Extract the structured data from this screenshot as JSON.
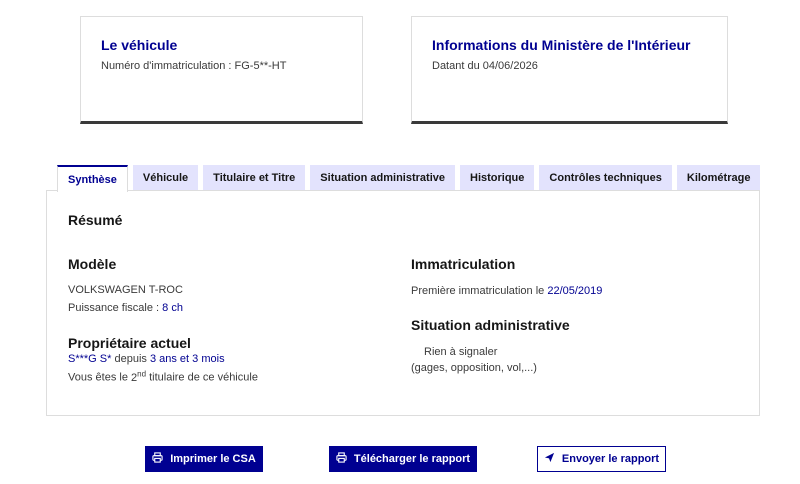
{
  "cards": {
    "vehicle": {
      "title": "Le véhicule",
      "plate_label": "Numéro d'immatriculation : FG-5**-HT"
    },
    "ministry": {
      "title": "Informations du Ministère de l'Intérieur",
      "date_label": "Datant du 04/06/2026"
    }
  },
  "tabs": [
    {
      "label": "Synthèse",
      "active": true
    },
    {
      "label": "Véhicule"
    },
    {
      "label": "Titulaire et Titre"
    },
    {
      "label": "Situation administrative"
    },
    {
      "label": "Historique"
    },
    {
      "label": "Contrôles techniques"
    },
    {
      "label": "Kilométrage"
    }
  ],
  "summary": {
    "title": "Résumé",
    "model": {
      "heading": "Modèle",
      "name": "VOLKSWAGEN T-ROC",
      "power_label": "Puissance fiscale :",
      "power_value": "8 ch"
    },
    "owner": {
      "heading": "Propriétaire actuel",
      "name": "S***G S*",
      "since_label": "depuis",
      "since_value": "3 ans et 3 mois",
      "rank_prefix": "Vous êtes le",
      "rank_number": "2",
      "rank_sup": "nd",
      "rank_suffix": "titulaire de ce véhicule"
    },
    "registration": {
      "heading": "Immatriculation",
      "first_label": "Première immatriculation le",
      "first_date": "22/05/2019"
    },
    "admin": {
      "heading": "Situation administrative",
      "status": "Rien à signaler",
      "details": "(gages, opposition, vol,...)"
    }
  },
  "buttons": {
    "print": "Imprimer le CSA",
    "download": "Télécharger le rapport",
    "send": "Envoyer le rapport"
  },
  "icons": {
    "print": "printer-icon",
    "download": "printer-icon",
    "send": "send-icon"
  },
  "colors": {
    "accent": "#000091",
    "tab_bg": "#e3e3fd",
    "text": "#3a3a3a"
  }
}
